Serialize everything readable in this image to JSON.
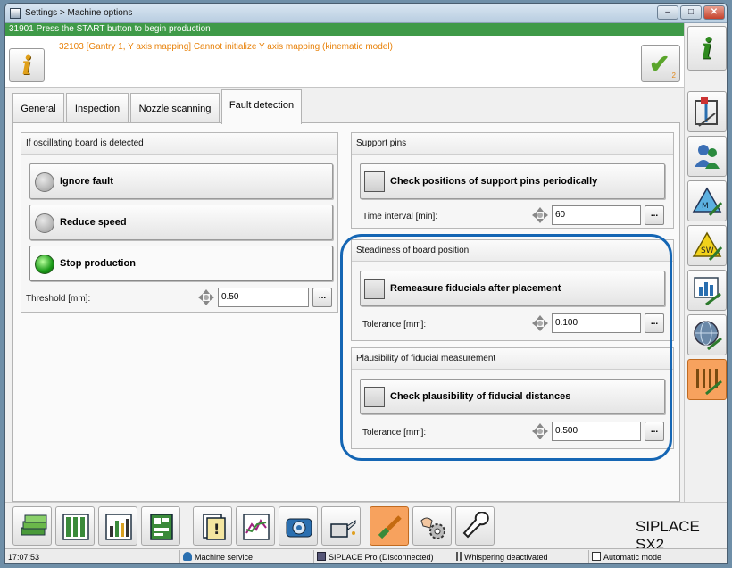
{
  "window": {
    "title": "Settings > Machine options",
    "min_icon": "minimize-icon",
    "max_icon": "maximize-icon",
    "close_icon": "close-icon"
  },
  "status": {
    "message": "31901 Press the START button to begin production",
    "color": "#3f9a48"
  },
  "error": {
    "message": "32103 [Gantry 1, Y axis mapping] Cannot initialize Y axis mapping (kinematic model)",
    "ack_count": "2",
    "color": "#e8820a"
  },
  "tabs": [
    {
      "label": "General"
    },
    {
      "label": "Inspection"
    },
    {
      "label": "Nozzle scanning"
    },
    {
      "label": "Fault detection",
      "active": true
    }
  ],
  "oscillating": {
    "title": "If oscillating board is detected",
    "options": [
      {
        "label": "Ignore fault",
        "selected": false
      },
      {
        "label": "Reduce speed",
        "selected": false
      },
      {
        "label": "Stop production",
        "selected": true
      }
    ],
    "threshold_label": "Threshold [mm]:",
    "threshold_value": "0.50"
  },
  "support_pins": {
    "title": "Support pins",
    "check_label": "Check positions of support pins periodically",
    "interval_label": "Time interval [min]:",
    "interval_value": "60"
  },
  "steadiness": {
    "title": "Steadiness of board position",
    "check_label": "Remeasure fiducials after placement",
    "tolerance_label": "Tolerance [mm]:",
    "tolerance_value": "0.100"
  },
  "plausibility": {
    "title": "Plausibility of fiducial measurement",
    "check_label": "Check plausibility of fiducial distances",
    "tolerance_label": "Tolerance [mm]:",
    "tolerance_value": "0.500"
  },
  "dots_label": "...",
  "brand": "SIPLACE SX2",
  "footer": {
    "time": "17:07:53",
    "service": "Machine service",
    "pro": "SIPLACE Pro (Disconnected)",
    "whisper": "Whispering deactivated",
    "mode": "Automatic mode"
  },
  "accent": "#1566b4",
  "active_color": "#f7a25e"
}
